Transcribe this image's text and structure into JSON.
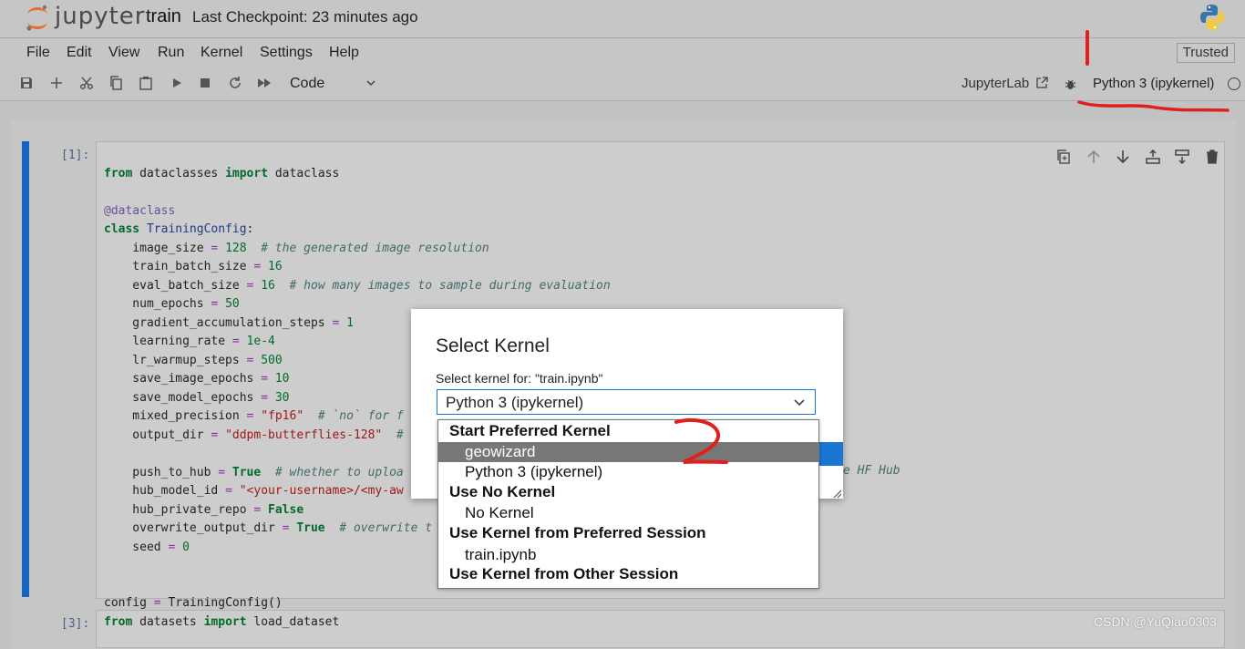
{
  "header": {
    "logo_text": "jupyter",
    "notebook_name": "train",
    "checkpoint": "Last Checkpoint: 23 minutes ago"
  },
  "menu": {
    "items": [
      "File",
      "Edit",
      "View",
      "Run",
      "Kernel",
      "Settings",
      "Help"
    ],
    "trusted": "Trusted"
  },
  "toolbar": {
    "cell_type": "Code",
    "jupyterlab": "JupyterLab",
    "kernel_name": "Python 3 (ipykernel)"
  },
  "cells": [
    {
      "prompt": "[1]:",
      "lines": [
        "from dataclasses import dataclass",
        "",
        "@dataclass",
        "class TrainingConfig:",
        "    image_size = 128  # the generated image resolution",
        "    train_batch_size = 16",
        "    eval_batch_size = 16  # how many images to sample during evaluation",
        "    num_epochs = 50",
        "    gradient_accumulation_steps = 1",
        "    learning_rate = 1e-4",
        "    lr_warmup_steps = 500",
        "    save_image_epochs = 10",
        "    save_model_epochs = 30",
        "    mixed_precision = \"fp16\"  # `no` for f",
        "    output_dir = \"ddpm-butterflies-128\"  #",
        "",
        "    push_to_hub = True  # whether to uploa",
        "    hub_model_id = \"<your-username>/<my-aw",
        "    hub_private_repo = False",
        "    overwrite_output_dir = True  # overwrite t",
        "    seed = 0",
        "",
        "",
        "config = TrainingConfig()"
      ],
      "trailing_visible": "e HF Hub"
    },
    {
      "prompt": "[3]:",
      "lines": [
        "from datasets import load_dataset"
      ]
    }
  ],
  "dialog": {
    "title": "Select Kernel",
    "label": "Select kernel for: \"train.ipynb\"",
    "selected": "Python 3 (ipykernel)",
    "groups": [
      {
        "heading": "Start Preferred Kernel",
        "options": [
          "geowizard",
          "Python 3 (ipykernel)"
        ]
      },
      {
        "heading": "Use No Kernel",
        "options": [
          "No Kernel"
        ]
      },
      {
        "heading": "Use Kernel from Preferred Session",
        "options": [
          "train.ipynb"
        ]
      },
      {
        "heading": "Use Kernel from Other Session",
        "options": []
      }
    ],
    "highlighted_option": "geowizard"
  },
  "annotations": {
    "step_number": "2",
    "color": "#e0201c"
  },
  "watermark": "CSDN @YuQiao0303",
  "colors": {
    "cell_active_bar": "#1565c0",
    "selection_highlight": "#777777",
    "dialog_focus": "#1976d2"
  }
}
